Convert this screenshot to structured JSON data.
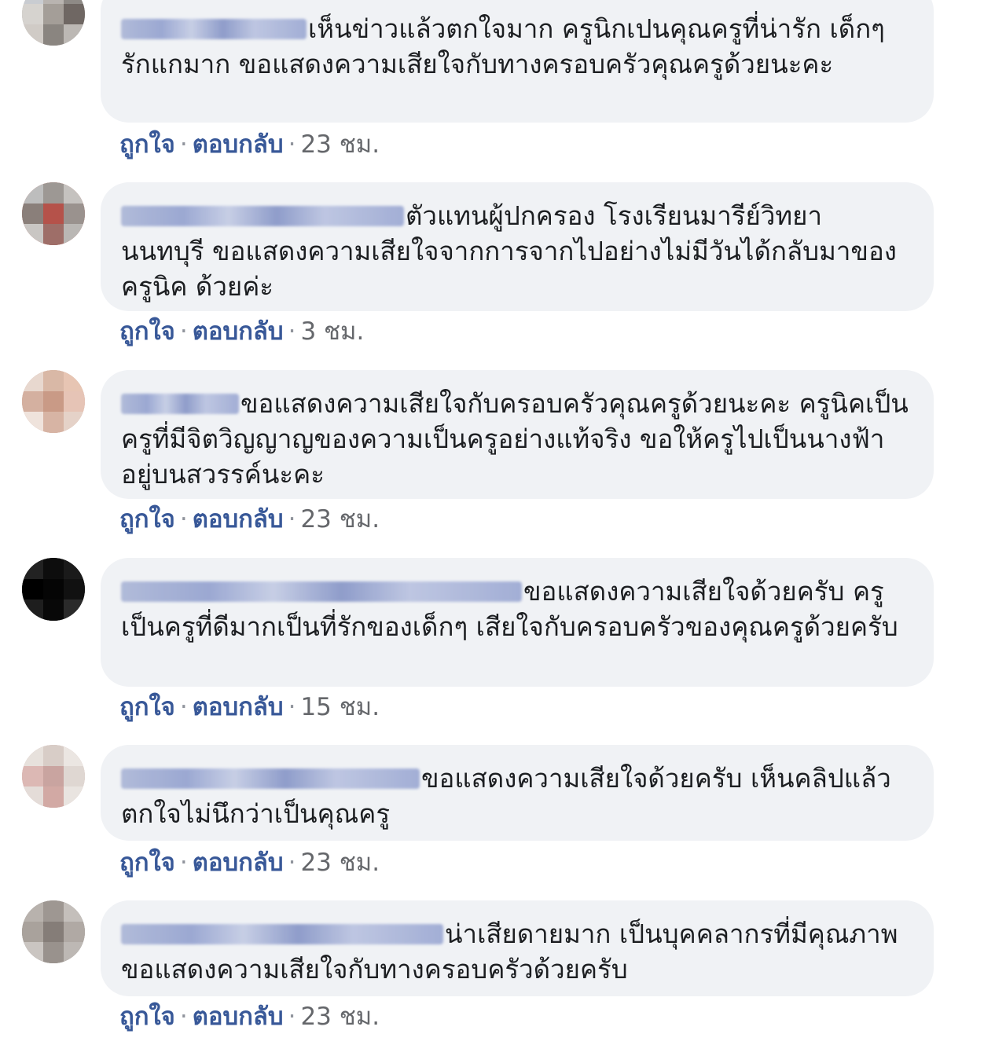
{
  "comments": [
    {
      "avatar_colors": [
        "#c9ccd1",
        "#b9b4b0",
        "#8e8a86",
        "#d6d3cf",
        "#a49e98",
        "#6f6763",
        "#d0cbc6",
        "#8a8580",
        "#bcb8b4"
      ],
      "name_blur_width": 236,
      "text": "เห็นข่าวแล้วตกใจมาก ครูนิกเปนคุณครูที่น่ารัก เด็กๆรักแกมาก ขอแสดงความเสียใจกับทางครอบครัวคุณครูด้วยนะคะ",
      "like": "ถูกใจ",
      "reply": "ตอบกลับ",
      "time": "23 ชม."
    },
    {
      "avatar_colors": [
        "#bdbdbd",
        "#9d9894",
        "#c5c2bf",
        "#8a7f7a",
        "#b5524a",
        "#9a928e",
        "#c9c6c3",
        "#9e6e68",
        "#bab7b4"
      ],
      "name_blur_width": 360,
      "text": "ตัวแทนผู้ปกครอง โรงเรียนมารีย์วิทยา นนทบุรี ขอแสดงความเสียใจจากการจากไปอย่างไม่มีวันได้กลับมาของครูนิค ด้วยค่ะ",
      "like": "ถูกใจ",
      "reply": "ตอบกลับ",
      "time": "3 ชม."
    },
    {
      "avatar_colors": [
        "#e8d8cf",
        "#d9b8a6",
        "#e7c5b3",
        "#d4b0a0",
        "#c99a86",
        "#e6c4b6",
        "#efe3dc",
        "#d7b4a4",
        "#e5d2c8"
      ],
      "name_blur_width": 150,
      "text": "ขอแสดงความเสียใจกับครอบครัวคุณครูด้วยนะคะ ครูนิคเป็นครูที่มีจิตวิญญาญของความเป็นครูอย่างแท้จริง ขอให้ครูไปเป็นนางฟ้าอยู่บนสวรรค์นะคะ",
      "like": "ถูกใจ",
      "reply": "ตอบกลับ",
      "time": "23 ชม."
    },
    {
      "avatar_colors": [
        "#222222",
        "#0d0d0d",
        "#1a1a1a",
        "#000000",
        "#050505",
        "#111111",
        "#1e1e1e",
        "#080808",
        "#2a2a2a"
      ],
      "name_blur_width": 510,
      "text": "ขอแสดงความเสียใจด้วยครับ ครูเป็นครูที่ดีมากเป็นที่รักของเด็กๆ เสียใจกับครอบครัวของคุณครูด้วยครับ",
      "like": "ถูกใจ",
      "reply": "ตอบกลับ",
      "time": "15 ชม."
    },
    {
      "avatar_colors": [
        "#e7e1dc",
        "#d8cdc7",
        "#ebe6e2",
        "#dcb8b4",
        "#c9a4a0",
        "#dfd7d2",
        "#e4dcd8",
        "#d2a9a4",
        "#e9e4e0"
      ],
      "name_blur_width": 380,
      "text": "ขอแสดงความเสียใจด้วยครับ เห็นคลิปแล้วตกใจไม่นึกว่าเป็นคุณครู",
      "like": "ถูกใจ",
      "reply": "ตอบกลับ",
      "time": "23 ชม."
    },
    {
      "avatar_colors": [
        "#b8b2ad",
        "#9e9792",
        "#c4bfbb",
        "#a9a29c",
        "#857d78",
        "#b0a9a4",
        "#cac5c1",
        "#99928d",
        "#bdb8b4"
      ],
      "name_blur_width": 410,
      "text": "น่าเสียดายมาก เป็นบุคคลากรที่มีคุณภาพ ขอแสดงความเสียใจกับทางครอบครัวด้วยครับ",
      "like": "ถูกใจ",
      "reply": "ตอบกลับ",
      "time": "23 ชม."
    }
  ],
  "separator": "·"
}
